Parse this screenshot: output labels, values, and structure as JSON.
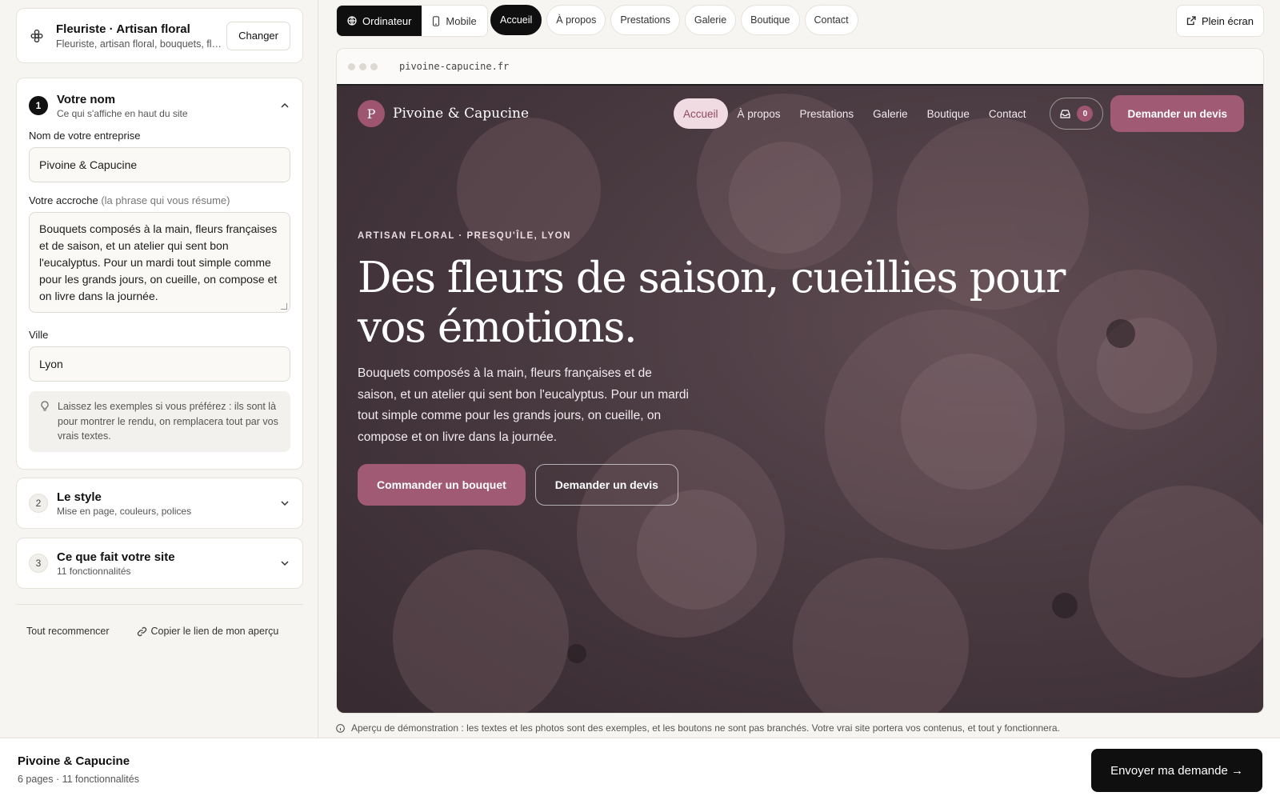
{
  "template": {
    "title": "Fleuriste · Artisan floral",
    "subtitle": "Fleuriste, artisan floral, bouquets, fleurs...",
    "change_label": "Changer"
  },
  "steps": [
    {
      "number": "1",
      "title": "Votre nom",
      "subtitle": "Ce qui s'affiche en haut du site"
    },
    {
      "number": "2",
      "title": "Le style",
      "subtitle": "Mise en page, couleurs, polices"
    },
    {
      "number": "3",
      "title": "Ce que fait votre site",
      "subtitle": "11 fonctionnalités"
    }
  ],
  "form": {
    "company_label": "Nom de votre entreprise",
    "company_value": "Pivoine & Capucine",
    "tagline_label": "Votre accroche",
    "tagline_hint": "(la phrase qui vous résume)",
    "tagline_value": "Bouquets composés à la main, fleurs françaises et de saison, et un atelier qui sent bon l'eucalyptus. Pour un mardi tout simple comme pour les grands jours, on cueille, on compose et on livre dans la journée.",
    "city_label": "Ville",
    "city_value": "Lyon",
    "tip": "Laissez les exemples si vous préférez : ils sont là pour montrer le rendu, on remplacera tout par vos vrais textes."
  },
  "sidebar_links": {
    "reset": "Tout recommencer",
    "copy": "Copier le lien de mon aperçu"
  },
  "device_toggle": [
    {
      "label": "Ordinateur",
      "icon": "globe-icon"
    },
    {
      "label": "Mobile",
      "icon": "phone-icon"
    }
  ],
  "page_tabs": [
    "Accueil",
    "À propos",
    "Prestations",
    "Galerie",
    "Boutique",
    "Contact"
  ],
  "fullscreen_label": "Plein écran",
  "browser": {
    "url": "pivoine-capucine.fr"
  },
  "site": {
    "logo_letter": "P",
    "name": "Pivoine & Capucine",
    "nav": [
      "Accueil",
      "À propos",
      "Prestations",
      "Galerie",
      "Boutique",
      "Contact"
    ],
    "cart_count": "0",
    "nav_cta": "Demander un devis",
    "kicker": "ARTISAN FLORAL · PRESQU'ÎLE, LYON",
    "headline": "Des fleurs de saison, cueillies pour vos émotions.",
    "lead": "Bouquets composés à la main, fleurs françaises et de saison, et un atelier qui sent bon l'eucalyptus. Pour un mardi tout simple comme pour les grands jours, on cueille, on compose et on livre dans la journée.",
    "primary_cta": "Commander un bouquet",
    "secondary_cta": "Demander un devis"
  },
  "demo_note": "Aperçu de démonstration : les textes et les photos sont des exemples, et les boutons ne sont pas branchés. Votre vrai site portera vos contenus, et tout y fonctionnera.",
  "footer": {
    "title": "Pivoine & Capucine",
    "subtitle": "6 pages · 11 fonctionnalités",
    "send_label": "Envoyer ma demande →"
  },
  "colors": {
    "accent": "#a15a73",
    "accent_light": "#f0dbe2",
    "dark": "#0f0f0f",
    "hero_overlay": "#4a3a40"
  }
}
